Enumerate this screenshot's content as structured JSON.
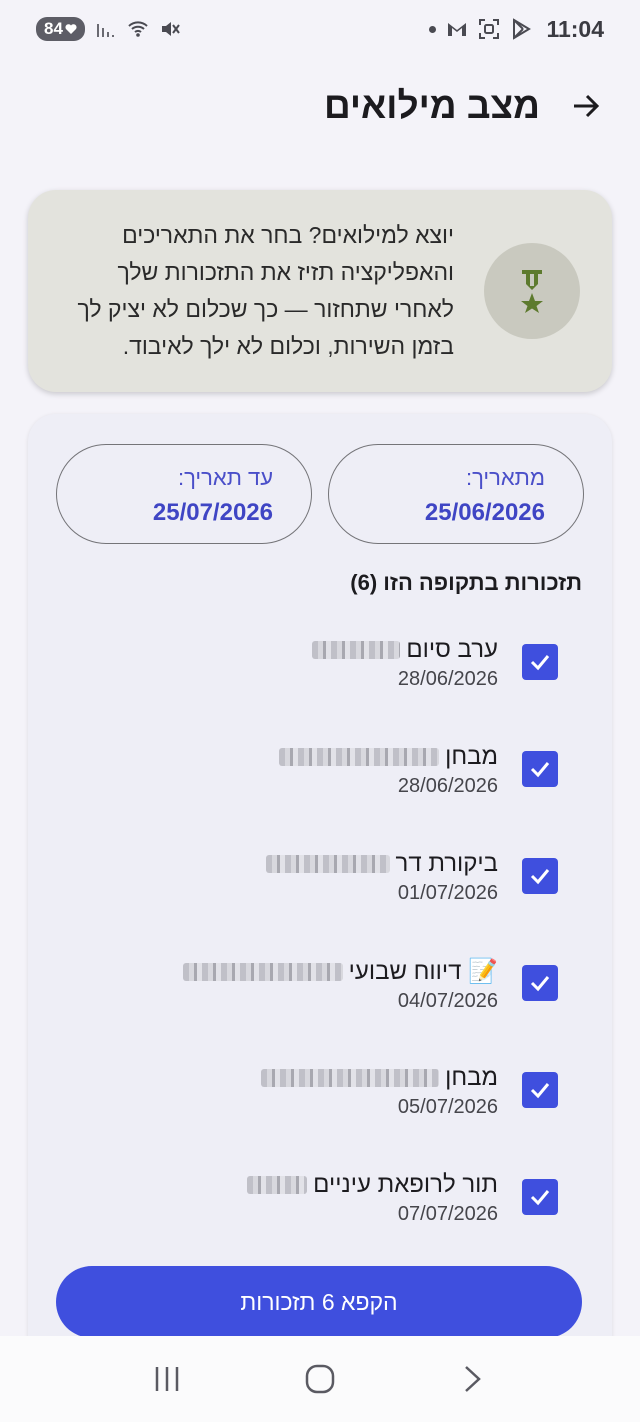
{
  "status_bar": {
    "battery": "84",
    "time": "11:04"
  },
  "app_bar": {
    "title": "מצב מילואים",
    "back_icon": "arrow-right-icon"
  },
  "info_card": {
    "icon": "medal-icon",
    "text": "יוצא למילואים? בחר את התאריכים והאפליקציה תזיז את התזכורות שלך לאחרי שתחזור — כך שכלום לא יציק לך בזמן השירות, וכלום לא ילך לאיבוד."
  },
  "date_range": {
    "from_label": "מתאריך:",
    "from_value": "25/06/2026",
    "to_label": "עד תאריך:",
    "to_value": "25/07/2026"
  },
  "reminders_section": {
    "title": "תזכורות בתקופה הזו (6)"
  },
  "reminders": [
    {
      "title": "ערב סיום",
      "date": "28/06/2026",
      "checked": true
    },
    {
      "title": "מבחן",
      "date": "28/06/2026",
      "checked": true
    },
    {
      "title": "ביקורת דר",
      "date": "01/07/2026",
      "checked": true
    },
    {
      "title": "📝 דיווח שבועי",
      "date": "04/07/2026",
      "checked": true
    },
    {
      "title": "מבחן",
      "date": "05/07/2026",
      "checked": true
    },
    {
      "title": "תור לרופאת עיניים",
      "date": "07/07/2026",
      "checked": true
    }
  ],
  "primary_action": {
    "label": "הקפא 6 תזכורות"
  },
  "colors": {
    "accent": "#3f4fde",
    "info_card_bg": "#e3e3dd",
    "medal": "#5d7a2e"
  }
}
